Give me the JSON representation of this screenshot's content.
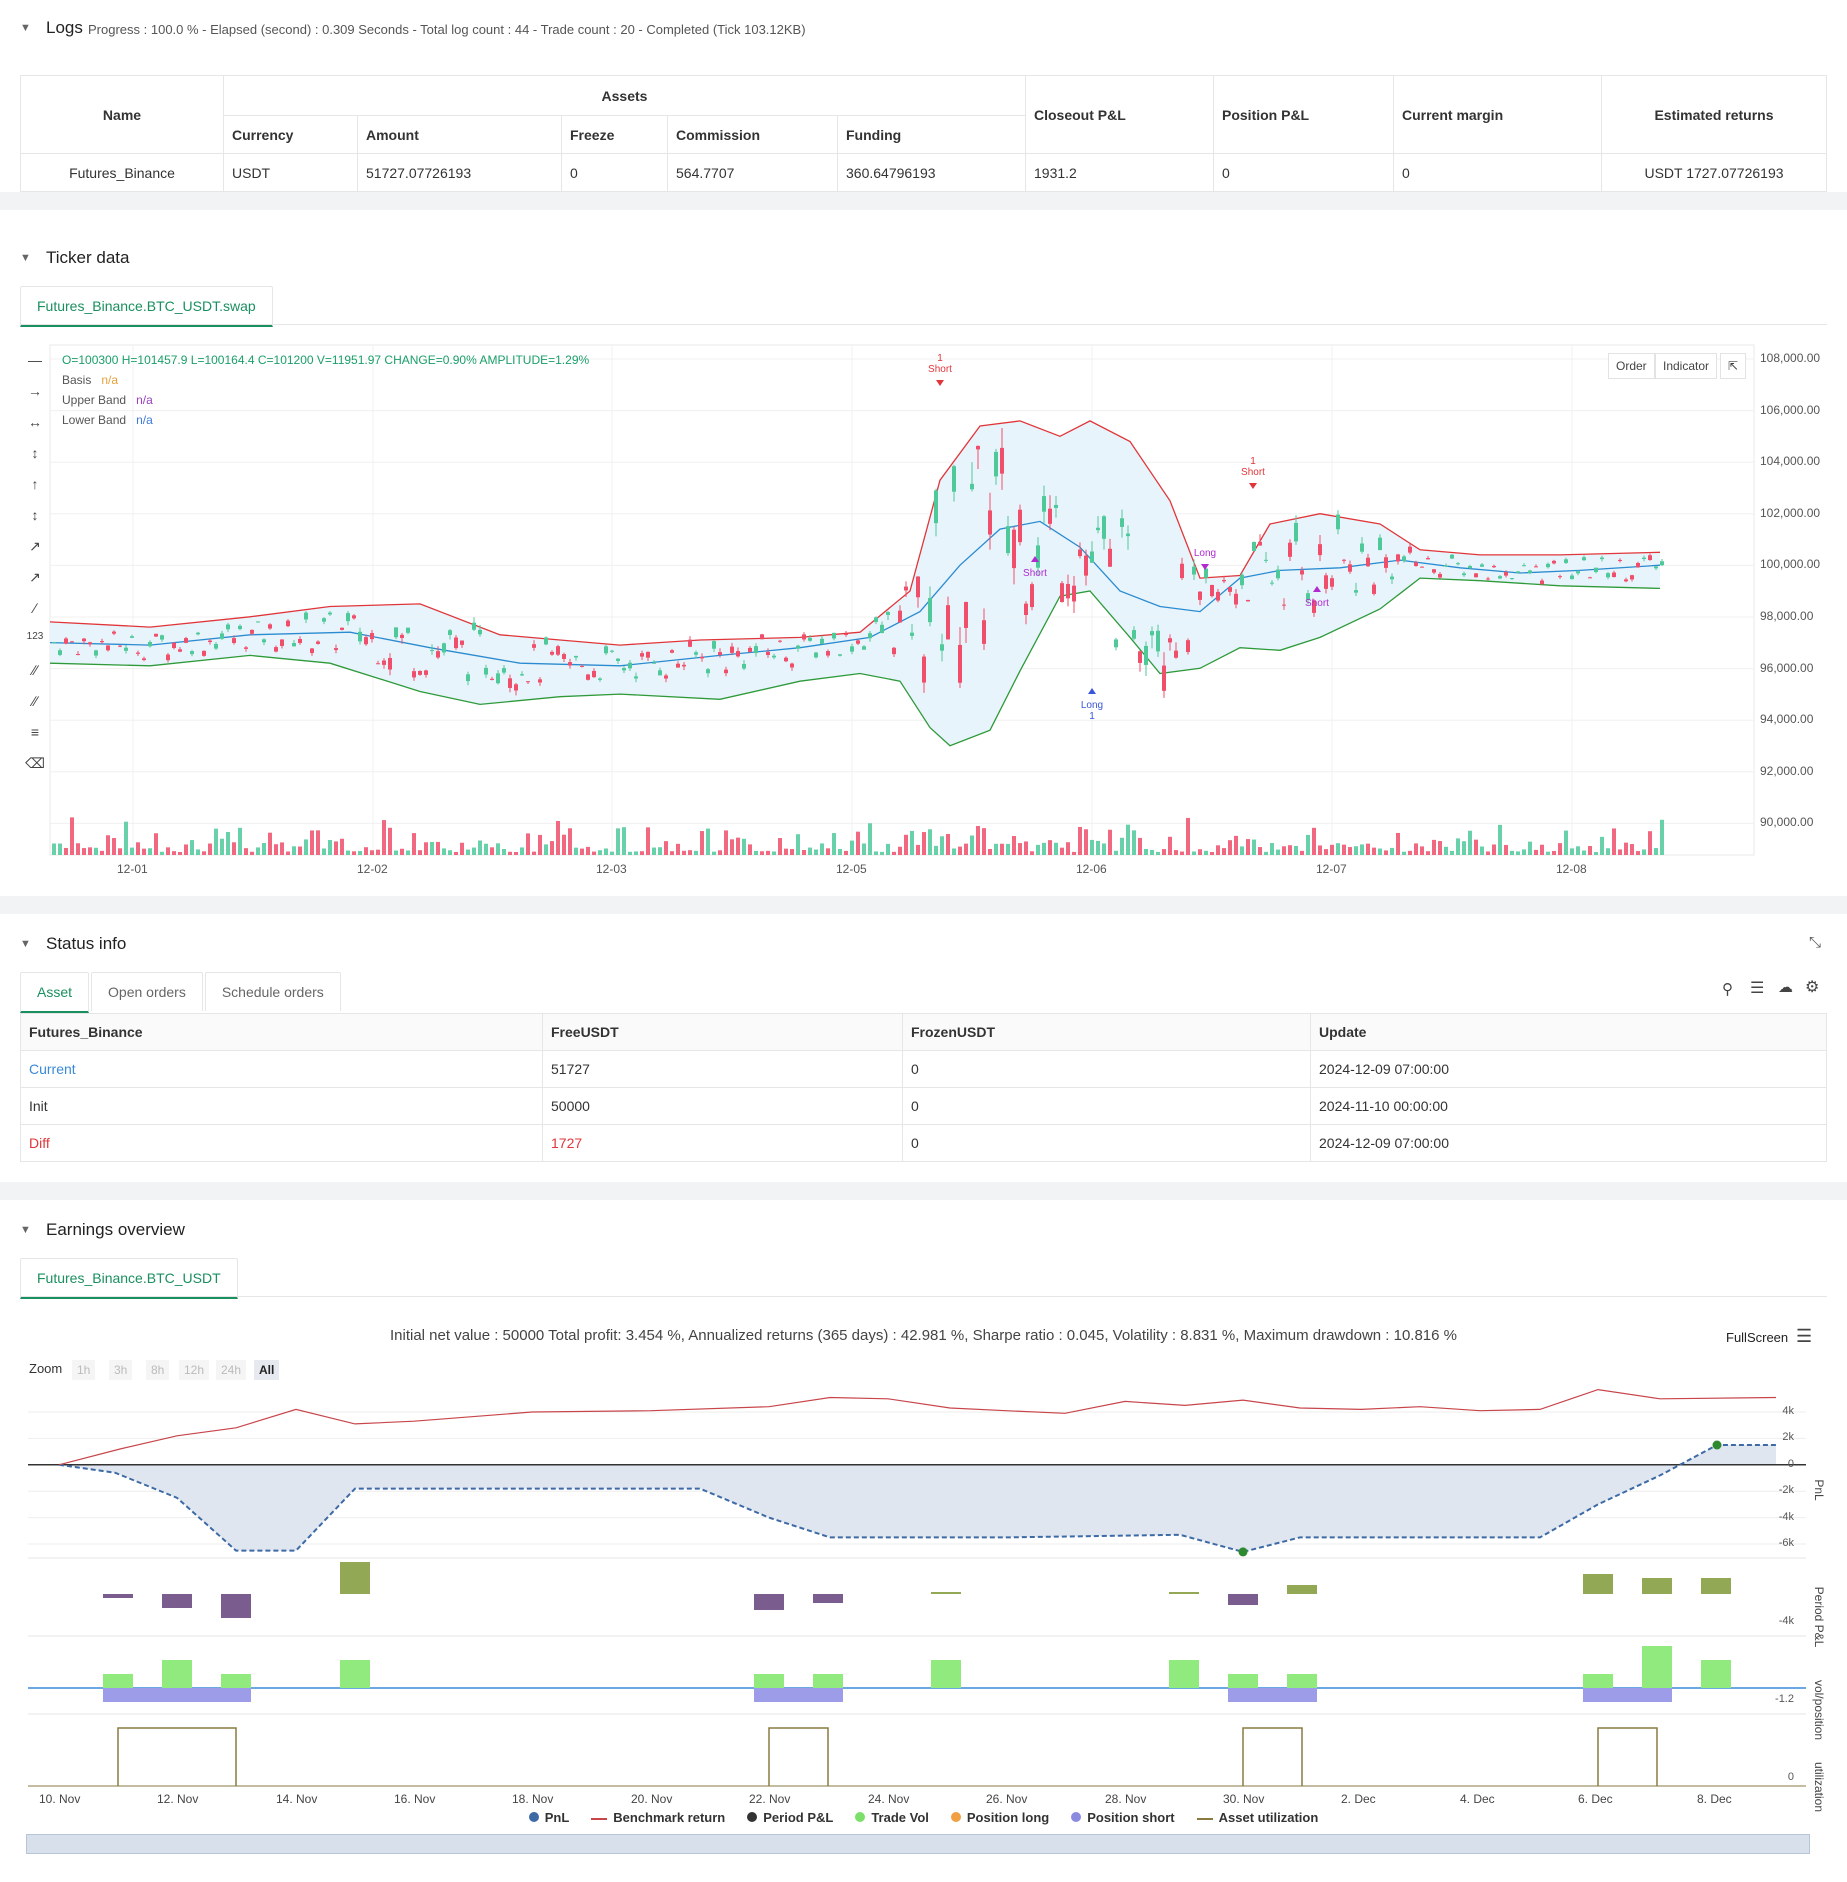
{
  "logs": {
    "title": "Logs",
    "progress": "Progress : 100.0 % - Elapsed (second) : 0.309  Seconds - Total log count : 44 - Trade count : 20 - Completed (Tick 103.12KB)",
    "table": {
      "name_header": "Name",
      "assets_header": "Assets",
      "sub_headers": [
        "Currency",
        "Amount",
        "Freeze",
        "Commission",
        "Funding"
      ],
      "right_headers": [
        "Closeout P&L",
        "Position P&L",
        "Current margin",
        "Estimated returns"
      ],
      "row": [
        "Futures_Binance",
        "USDT",
        "51727.07726193",
        "0",
        "564.7707",
        "360.64796193",
        "1931.2",
        "0",
        "0",
        "USDT 1727.07726193"
      ]
    }
  },
  "ticker": {
    "title": "Ticker data",
    "tab": "Futures_Binance.BTC_USDT.swap",
    "ohlc": "O=100300 H=101457.9 L=100164.4 C=101200 V=11951.97 CHANGE=0.90% AMPLITUDE=1.29%",
    "legend": [
      {
        "name": "Basis",
        "value": "n/a",
        "color": "#e8a13a"
      },
      {
        "name": "Upper Band",
        "value": "n/a",
        "color": "#9b3fbf"
      },
      {
        "name": "Lower Band",
        "value": "n/a",
        "color": "#3a7bd5"
      }
    ],
    "buttons": {
      "order": "Order",
      "indicator": "Indicator"
    },
    "yaxis": [
      "108,000.00",
      "106,000.00",
      "104,000.00",
      "102,000.00",
      "100,000.00",
      "98,000.00",
      "96,000.00",
      "94,000.00",
      "92,000.00",
      "90,000.00"
    ],
    "xaxis": [
      "12-01",
      "12-02",
      "12-03",
      "12-05",
      "12-06",
      "12-07",
      "12-08"
    ],
    "markers": [
      {
        "label": "Short",
        "num": "1",
        "color": "#e0363a"
      },
      {
        "label": "Short",
        "num": "",
        "color": "#b02ad0"
      },
      {
        "label": "Long",
        "num": "1",
        "color": "#3a56d8"
      },
      {
        "label": "Long",
        "num": "",
        "color": "#b02ad0"
      },
      {
        "label": "Short",
        "num": "1",
        "color": "#e0363a"
      },
      {
        "label": "Short",
        "num": "",
        "color": "#b02ad0"
      }
    ]
  },
  "status": {
    "title": "Status info",
    "tabs": [
      "Asset",
      "Open orders",
      "Schedule orders"
    ],
    "headers": [
      "Futures_Binance",
      "FreeUSDT",
      "FrozenUSDT",
      "Update"
    ],
    "rows": [
      [
        "Current",
        "51727",
        "0",
        "2024-12-09 07:00:00"
      ],
      [
        "Init",
        "50000",
        "0",
        "2024-11-10 00:00:00"
      ],
      [
        "Diff",
        "1727",
        "0",
        "2024-12-09 07:00:00"
      ]
    ]
  },
  "earnings": {
    "title": "Earnings overview",
    "tab": "Futures_Binance.BTC_USDT",
    "summary": "Initial net value : 50000  Total profit: 3.454 %, Annualized returns (365 days) : 42.981 %, Sharpe ratio : 0.045, Volatility : 8.831 %, Maximum drawdown : 10.816 %",
    "fullscreen": "FullScreen",
    "zoom_label": "Zoom",
    "zoom_buttons": [
      "1h",
      "3h",
      "8h",
      "12h",
      "24h",
      "All"
    ],
    "pnl_axis": [
      "4k",
      "2k",
      "0",
      "-2k",
      "-4k",
      "-6k"
    ],
    "period_axis": "-4k",
    "vol_axis": "-1.2",
    "util_axis": "0",
    "axis_titles": [
      "PnL",
      "Period P&L",
      "vol/position",
      "utilization"
    ],
    "xaxis": [
      "10. Nov",
      "12. Nov",
      "14. Nov",
      "16. Nov",
      "18. Nov",
      "20. Nov",
      "22. Nov",
      "24. Nov",
      "26. Nov",
      "28. Nov",
      "30. Nov",
      "2. Dec",
      "4. Dec",
      "6. Dec",
      "8. Dec"
    ],
    "legend": [
      {
        "name": "PnL",
        "color": "#3d6aa5",
        "kind": "dot"
      },
      {
        "name": "Benchmark return",
        "color": "#c8454a",
        "kind": "line"
      },
      {
        "name": "Period P&L",
        "color": "#333333",
        "kind": "dot"
      },
      {
        "name": "Trade Vol",
        "color": "#7be06a",
        "kind": "dot"
      },
      {
        "name": "Position long",
        "color": "#f0a040",
        "kind": "dot"
      },
      {
        "name": "Position short",
        "color": "#8a8ae0",
        "kind": "dot"
      },
      {
        "name": "Asset utilization",
        "color": "#8a7a40",
        "kind": "line"
      }
    ]
  },
  "colors": {
    "accent": "#1a8f5f",
    "up": "#4fc99a",
    "down": "#ef4f6a",
    "upper": "#e0363a",
    "lower": "#2e9a3a",
    "basis": "#2a8bd0"
  }
}
